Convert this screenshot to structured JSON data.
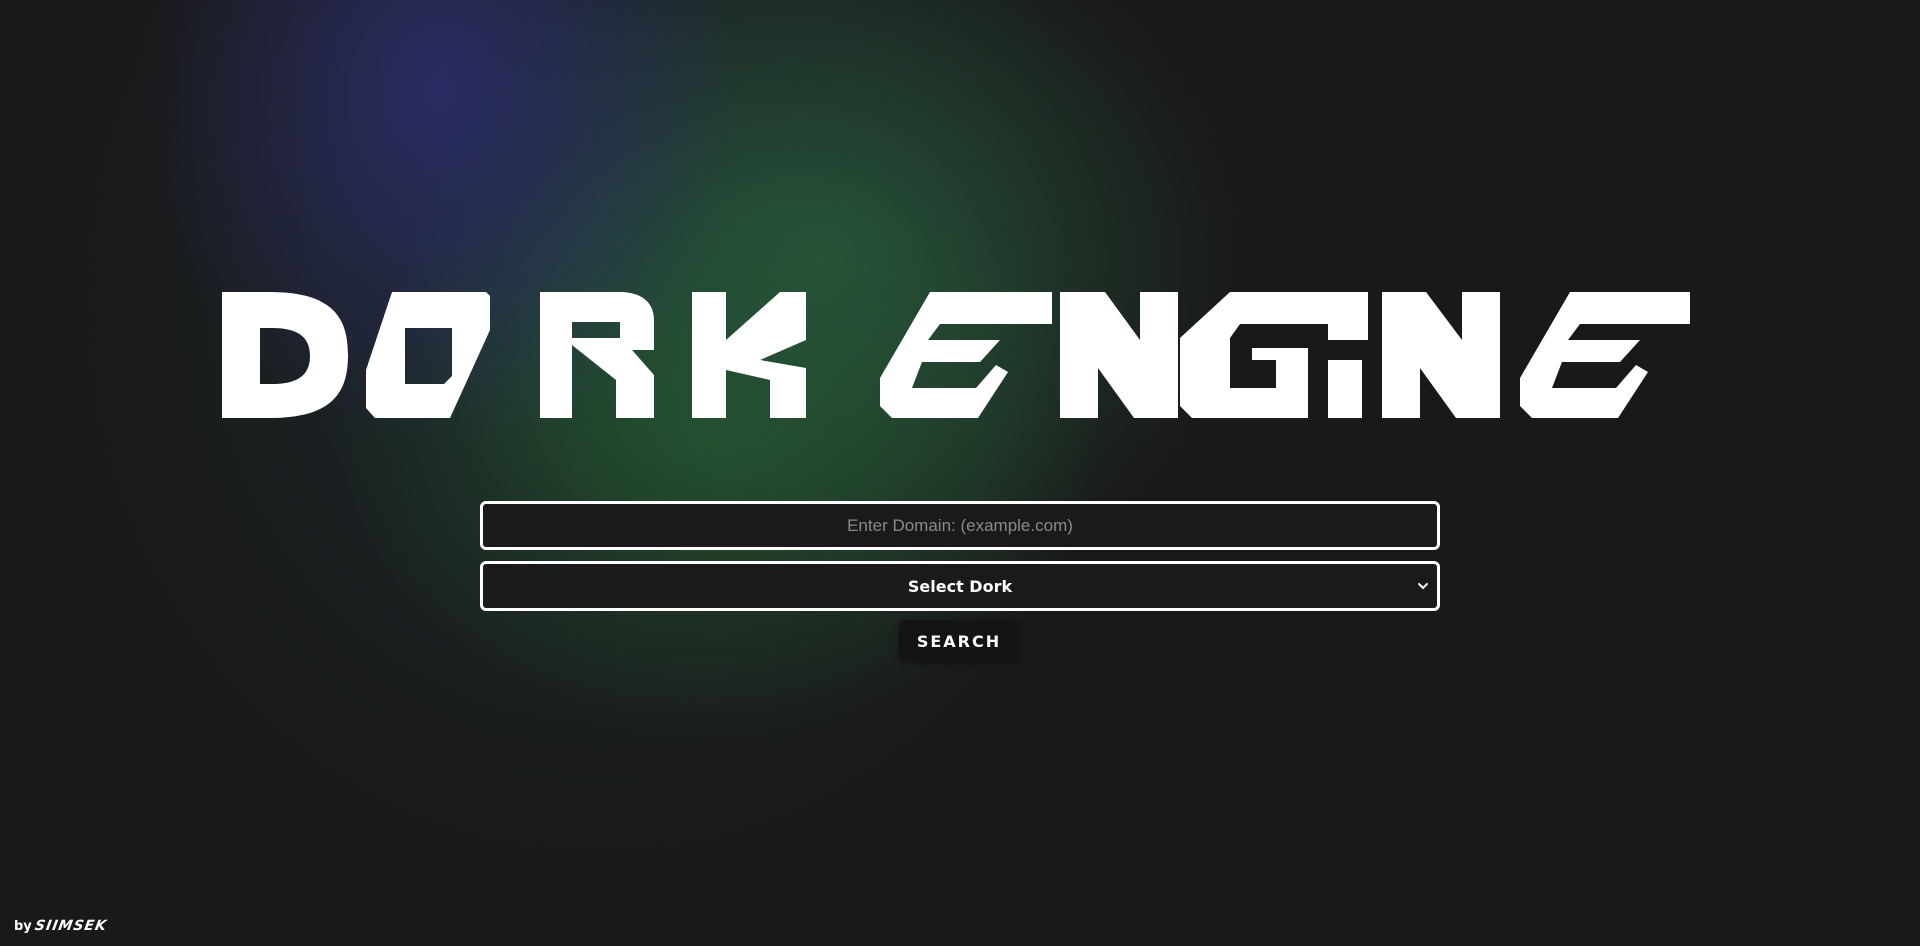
{
  "app": {
    "title": "DORK ENGINE"
  },
  "search": {
    "domain_placeholder": "Enter Domain: (example.com)",
    "domain_value": "",
    "dork_select_label": "Select Dork",
    "search_button_label": "SEARCH"
  },
  "footer": {
    "by_label": "by",
    "author": "SIIMSEK"
  },
  "colors": {
    "background": "#191919",
    "text": "#ffffff",
    "glow_blue": "#2d2d6e",
    "glow_green": "#28593c"
  }
}
